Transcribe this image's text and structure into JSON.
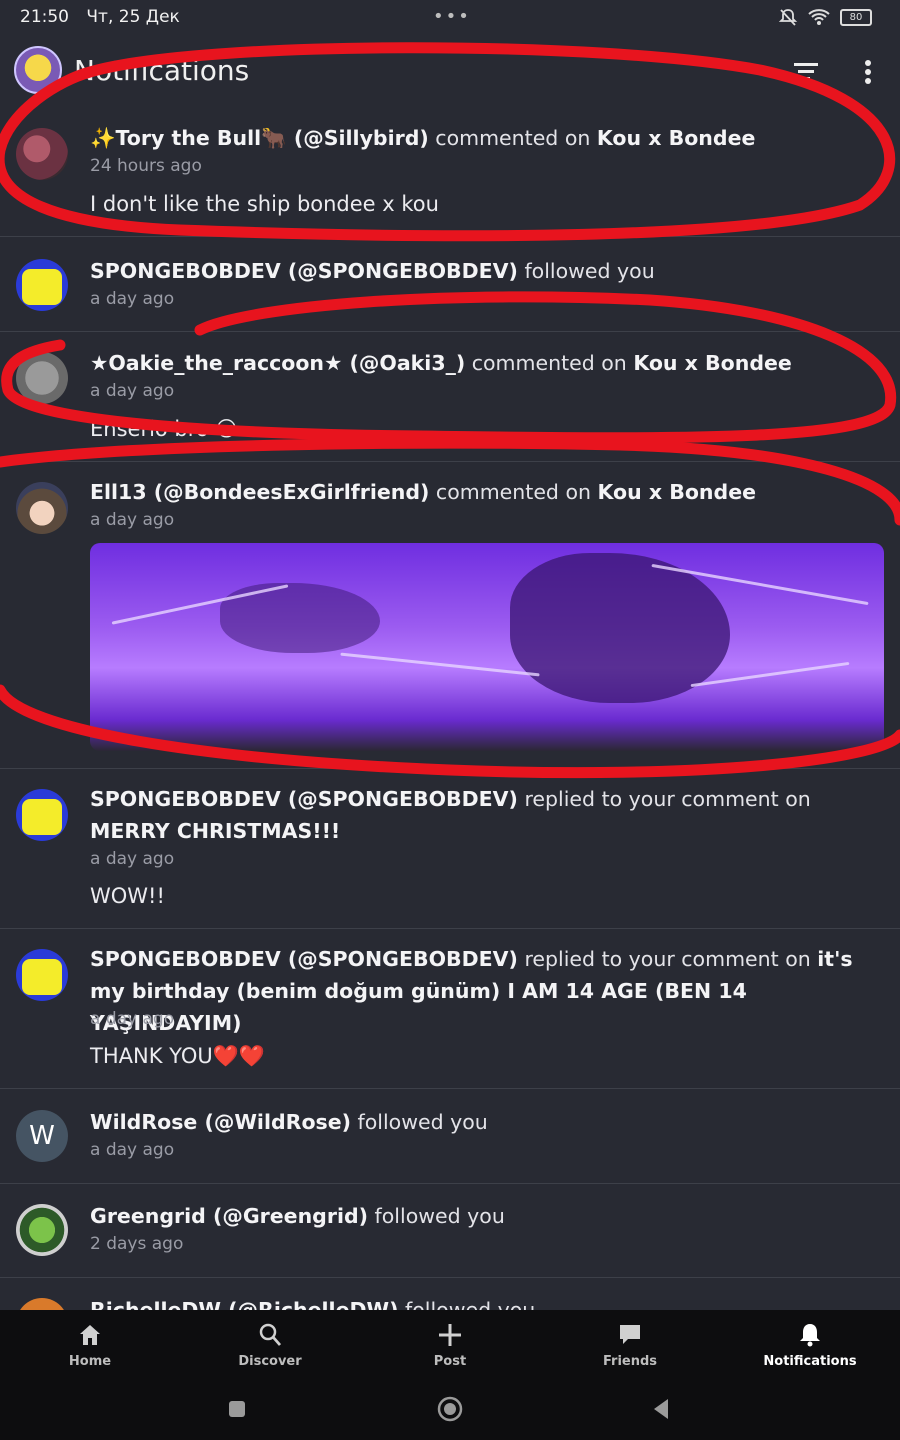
{
  "status": {
    "time": "21:50",
    "date": "Чт, 25 Дек",
    "dots": "•••",
    "battery": "80"
  },
  "appbar": {
    "title": "Notifications"
  },
  "notifications": [
    {
      "parts": [
        "✨Tory the Bull🐂 (@Sillybird)",
        " commented on ",
        "Kou x Bondee",
        ""
      ],
      "time": "24 hours ago",
      "body": "I don't like the ship  bondee x kou"
    },
    {
      "parts": [
        "SPONGEBOBDEV (@SPONGEBOBDEV)",
        " followed you",
        "",
        ""
      ],
      "time": "a day ago",
      "body": ""
    },
    {
      "parts": [
        "★Oakie_the_raccoon★ (@Oaki3_)",
        " commented on ",
        "Kou x Bondee",
        ""
      ],
      "time": "a day ago",
      "body": "Enserio bro 😑"
    },
    {
      "parts": [
        "Ell13 (@BondeesExGirlfriend)",
        " commented on ",
        "Kou x Bondee",
        ""
      ],
      "time": "a day ago",
      "body": ""
    },
    {
      "parts": [
        "SPONGEBOBDEV (@SPONGEBOBDEV)",
        " replied to your comment on ",
        "MERRY CHRISTMAS!!!",
        ""
      ],
      "time": "a day ago",
      "body": "WOW!!"
    },
    {
      "parts": [
        "SPONGEBOBDEV (@SPONGEBOBDEV)",
        " replied to your comment on ",
        "it's my birthday (benim doğum günüm) I AM 14 AGE (BEN 14 YAŞINDAYIM)",
        ""
      ],
      "time": "a day ago",
      "body": "THANK YOU❤️❤️"
    },
    {
      "parts": [
        "WildRose (@WildRose)",
        " followed you",
        "",
        ""
      ],
      "time": "a day ago",
      "body": "",
      "avatar_letter": "W"
    },
    {
      "parts": [
        "Greengrid (@Greengrid)",
        " followed you",
        "",
        ""
      ],
      "time": "2 days ago",
      "body": ""
    },
    {
      "parts": [
        "RichelleDW (@RichelleDW)",
        " followed you",
        "",
        ""
      ],
      "time": "",
      "body": ""
    }
  ],
  "nav": {
    "home": "Home",
    "discover": "Discover",
    "post": "Post",
    "friends": "Friends",
    "notifications": "Notifications"
  },
  "colors": {
    "background": "#282a33",
    "annotation": "#e8141e",
    "navbar": "#0d0d0f"
  },
  "icons": [
    "filter-icon",
    "more-vert-icon",
    "home-icon",
    "search-icon",
    "plus-icon",
    "chat-icon",
    "bell-icon",
    "mute-icon",
    "wifi-icon",
    "battery-icon"
  ]
}
